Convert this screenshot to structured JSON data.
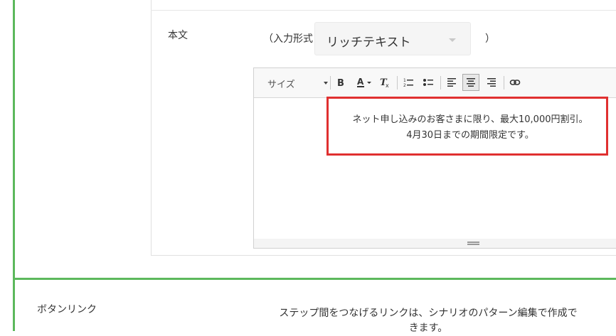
{
  "body_field": {
    "label": "本文",
    "input_format_prefix": "（入力形式",
    "input_format_suffix": "）",
    "format_select": {
      "value": "リッチテキスト"
    }
  },
  "editor": {
    "toolbar": {
      "size_label": "サイズ",
      "buttons": [
        {
          "name": "bold",
          "icon": "bold-icon"
        },
        {
          "name": "text-color",
          "icon": "text-color-icon"
        },
        {
          "name": "remove-format",
          "icon": "remove-format-icon"
        },
        {
          "name": "numbered-list",
          "icon": "numbered-list-icon"
        },
        {
          "name": "bulleted-list",
          "icon": "bulleted-list-icon"
        },
        {
          "name": "align-left",
          "icon": "align-left-icon"
        },
        {
          "name": "align-center",
          "icon": "align-center-icon",
          "active": true
        },
        {
          "name": "align-right",
          "icon": "align-right-icon"
        },
        {
          "name": "link",
          "icon": "link-icon"
        }
      ]
    },
    "content": {
      "line1": "ネット申し込みのお客さまに限り、最大10,000円割引。",
      "line2": "4月30日までの期間限定です。"
    }
  },
  "button_link": {
    "label": "ボタンリンク",
    "description": "ステップ間をつなげるリンクは、シナリオのパターン編集で作成できます。"
  },
  "colors": {
    "green_border": "#5cb85c",
    "highlight_red": "#e03030"
  }
}
